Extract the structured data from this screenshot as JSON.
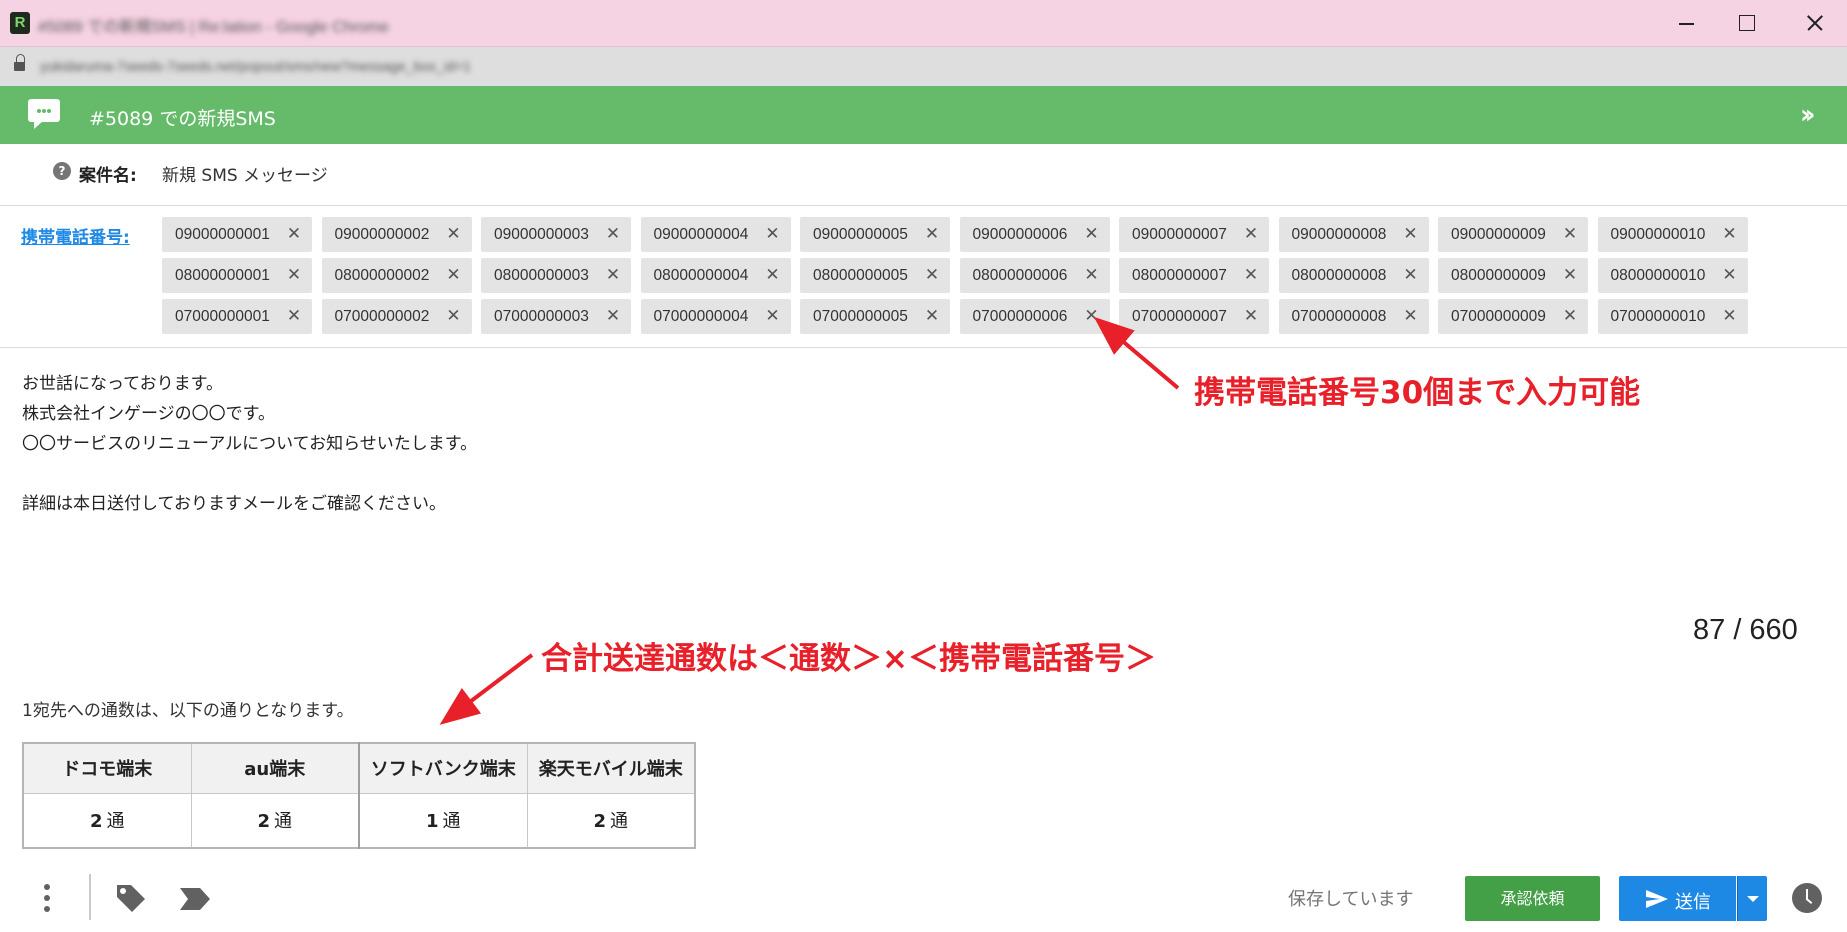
{
  "browser": {
    "window_title": "#5089 での新規SMS | Re:lation - Google Chrome",
    "url": "yukidaruma-7seeds-7seeds.net/popout/sms/new?message_box_id=1"
  },
  "header": {
    "title": "#5089 での新規SMS",
    "collapse_icon": "double-chevron-right-icon"
  },
  "subject": {
    "label": "案件名:",
    "value": "新規 SMS メッセージ"
  },
  "phones": {
    "label": "携帯電話番号:",
    "remove_glyph": "✕",
    "numbers": [
      "09000000001",
      "09000000002",
      "09000000003",
      "09000000004",
      "09000000005",
      "09000000006",
      "09000000007",
      "09000000008",
      "09000000009",
      "09000000010",
      "08000000001",
      "08000000002",
      "08000000003",
      "08000000004",
      "08000000005",
      "08000000006",
      "08000000007",
      "08000000008",
      "08000000009",
      "08000000010",
      "07000000001",
      "07000000002",
      "07000000003",
      "07000000004",
      "07000000005",
      "07000000006",
      "07000000007",
      "07000000008",
      "07000000009",
      "07000000010"
    ]
  },
  "message": {
    "lines": [
      "お世話になっております。",
      "株式会社インゲージの〇〇です。",
      "〇〇サービスのリニューアルについてお知らせいたします。",
      "",
      "詳細は本日送付しておりますメールをご確認ください。"
    ],
    "char_count": "87 / 660"
  },
  "per_recipient": {
    "caption": "1宛先への通数は、以下の通りとなります。",
    "unit": "通",
    "carriers": [
      {
        "name": "ドコモ端末",
        "count": "2"
      },
      {
        "name": "au端末",
        "count": "2"
      },
      {
        "name": "ソフトバンク端末",
        "count": "1"
      },
      {
        "name": "楽天モバイル端末",
        "count": "2"
      }
    ]
  },
  "annotations": {
    "top": "携帯電話番号30個まで入力可能",
    "bottom": "合計送達通数は＜通数＞×＜携帯電話番号＞",
    "color": "#e8202a"
  },
  "footer": {
    "save_status": "保存しています",
    "approve_label": "承認依頼",
    "send_label": "送信"
  },
  "colors": {
    "header_green": "#66bb6a",
    "approve_green": "#43a047",
    "send_blue": "#1e88e5",
    "link_blue": "#1e88e5"
  }
}
